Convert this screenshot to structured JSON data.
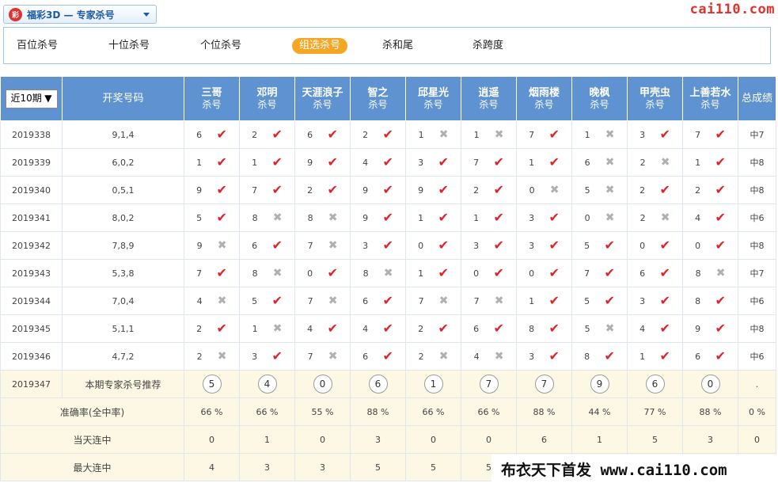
{
  "game": {
    "logo": "彩",
    "title": "福彩3D — 专家杀号"
  },
  "watermark_top": "cai110.com",
  "tabs": [
    {
      "label": "百位杀号",
      "active": false
    },
    {
      "label": "十位杀号",
      "active": false
    },
    {
      "label": "个位杀号",
      "active": false
    },
    {
      "label": "组选杀号",
      "active": true
    },
    {
      "label": "杀和尾",
      "active": false
    },
    {
      "label": "杀跨度",
      "active": false
    }
  ],
  "period_select": {
    "value": "近10期",
    "caret": "▼"
  },
  "header": {
    "draw_numbers": "开奖号码",
    "total": "总成绩",
    "kill_label": "杀号",
    "experts": [
      "三哥",
      "邓明",
      "天涯浪子",
      "智之",
      "邱星光",
      "逍遥",
      "烟雨楼",
      "晚枫",
      "甲壳虫",
      "上善若水"
    ]
  },
  "rows": [
    {
      "period": "2019338",
      "numbers": "9,1,4",
      "cells": [
        [
          "6",
          1
        ],
        [
          "2",
          1
        ],
        [
          "6",
          1
        ],
        [
          "2",
          1
        ],
        [
          "1",
          0
        ],
        [
          "1",
          0
        ],
        [
          "7",
          1
        ],
        [
          "1",
          0
        ],
        [
          "3",
          1
        ],
        [
          "7",
          1
        ]
      ],
      "total": "中7"
    },
    {
      "period": "2019339",
      "numbers": "6,0,2",
      "cells": [
        [
          "1",
          1
        ],
        [
          "1",
          1
        ],
        [
          "9",
          1
        ],
        [
          "4",
          1
        ],
        [
          "3",
          1
        ],
        [
          "7",
          1
        ],
        [
          "1",
          1
        ],
        [
          "6",
          0
        ],
        [
          "2",
          0
        ],
        [
          "1",
          1
        ]
      ],
      "total": "中8"
    },
    {
      "period": "2019340",
      "numbers": "0,5,1",
      "cells": [
        [
          "9",
          1
        ],
        [
          "7",
          1
        ],
        [
          "2",
          1
        ],
        [
          "9",
          1
        ],
        [
          "9",
          1
        ],
        [
          "2",
          1
        ],
        [
          "0",
          0
        ],
        [
          "5",
          0
        ],
        [
          "2",
          1
        ],
        [
          "2",
          1
        ]
      ],
      "total": "中8"
    },
    {
      "period": "2019341",
      "numbers": "8,0,2",
      "cells": [
        [
          "5",
          1
        ],
        [
          "8",
          0
        ],
        [
          "8",
          0
        ],
        [
          "9",
          1
        ],
        [
          "1",
          1
        ],
        [
          "1",
          1
        ],
        [
          "3",
          1
        ],
        [
          "0",
          0
        ],
        [
          "2",
          0
        ],
        [
          "4",
          1
        ]
      ],
      "total": "中6"
    },
    {
      "period": "2019342",
      "numbers": "7,8,9",
      "cells": [
        [
          "9",
          0
        ],
        [
          "6",
          1
        ],
        [
          "7",
          0
        ],
        [
          "3",
          1
        ],
        [
          "0",
          1
        ],
        [
          "3",
          1
        ],
        [
          "3",
          1
        ],
        [
          "5",
          1
        ],
        [
          "0",
          1
        ],
        [
          "0",
          1
        ]
      ],
      "total": "中8"
    },
    {
      "period": "2019343",
      "numbers": "5,3,8",
      "cells": [
        [
          "7",
          1
        ],
        [
          "8",
          0
        ],
        [
          "0",
          1
        ],
        [
          "8",
          0
        ],
        [
          "1",
          1
        ],
        [
          "0",
          1
        ],
        [
          "0",
          1
        ],
        [
          "7",
          1
        ],
        [
          "6",
          1
        ],
        [
          "8",
          0
        ]
      ],
      "total": "中7"
    },
    {
      "period": "2019344",
      "numbers": "7,0,4",
      "cells": [
        [
          "4",
          0
        ],
        [
          "5",
          1
        ],
        [
          "7",
          0
        ],
        [
          "6",
          1
        ],
        [
          "7",
          0
        ],
        [
          "7",
          0
        ],
        [
          "1",
          1
        ],
        [
          "5",
          1
        ],
        [
          "3",
          1
        ],
        [
          "8",
          1
        ]
      ],
      "total": "中6"
    },
    {
      "period": "2019345",
      "numbers": "5,1,1",
      "cells": [
        [
          "2",
          1
        ],
        [
          "1",
          0
        ],
        [
          "4",
          1
        ],
        [
          "4",
          1
        ],
        [
          "2",
          1
        ],
        [
          "6",
          1
        ],
        [
          "8",
          1
        ],
        [
          "5",
          0
        ],
        [
          "4",
          1
        ],
        [
          "9",
          1
        ]
      ],
      "total": "中8"
    },
    {
      "period": "2019346",
      "numbers": "4,7,2",
      "cells": [
        [
          "2",
          0
        ],
        [
          "3",
          1
        ],
        [
          "7",
          0
        ],
        [
          "6",
          1
        ],
        [
          "2",
          0
        ],
        [
          "4",
          0
        ],
        [
          "3",
          1
        ],
        [
          "8",
          1
        ],
        [
          "1",
          1
        ],
        [
          "6",
          1
        ]
      ],
      "total": "中6"
    }
  ],
  "recommend": {
    "period": "2019347",
    "label": "本期专家杀号推荐",
    "values": [
      "5",
      "4",
      "0",
      "6",
      "1",
      "7",
      "7",
      "9",
      "6",
      "0"
    ],
    "total": "."
  },
  "accuracy": {
    "label": "准确率(全中率)",
    "values": [
      "66 %",
      "66 %",
      "55 %",
      "88 %",
      "66 %",
      "66 %",
      "88 %",
      "44 %",
      "77 %",
      "88 %"
    ],
    "total": "0 %"
  },
  "current_streak": {
    "label": "当天连中",
    "values": [
      "0",
      "1",
      "0",
      "3",
      "0",
      "0",
      "6",
      "1",
      "5",
      "3"
    ],
    "total": "0"
  },
  "max_streak": {
    "label": "最大连中",
    "values": [
      "4",
      "3",
      "3",
      "5",
      "5",
      "5",
      "",
      "",
      "",
      "",
      ""
    ],
    "total": ""
  },
  "watermark_bottom": "布衣天下首发 www.cai110.com",
  "colors": {
    "header_bg": "#5e92d0",
    "ok_mark": "#e0232b",
    "bad_mark": "#b0b0b0",
    "tab_active": "#f5a623",
    "yellow_row": "#fcf8e3"
  }
}
